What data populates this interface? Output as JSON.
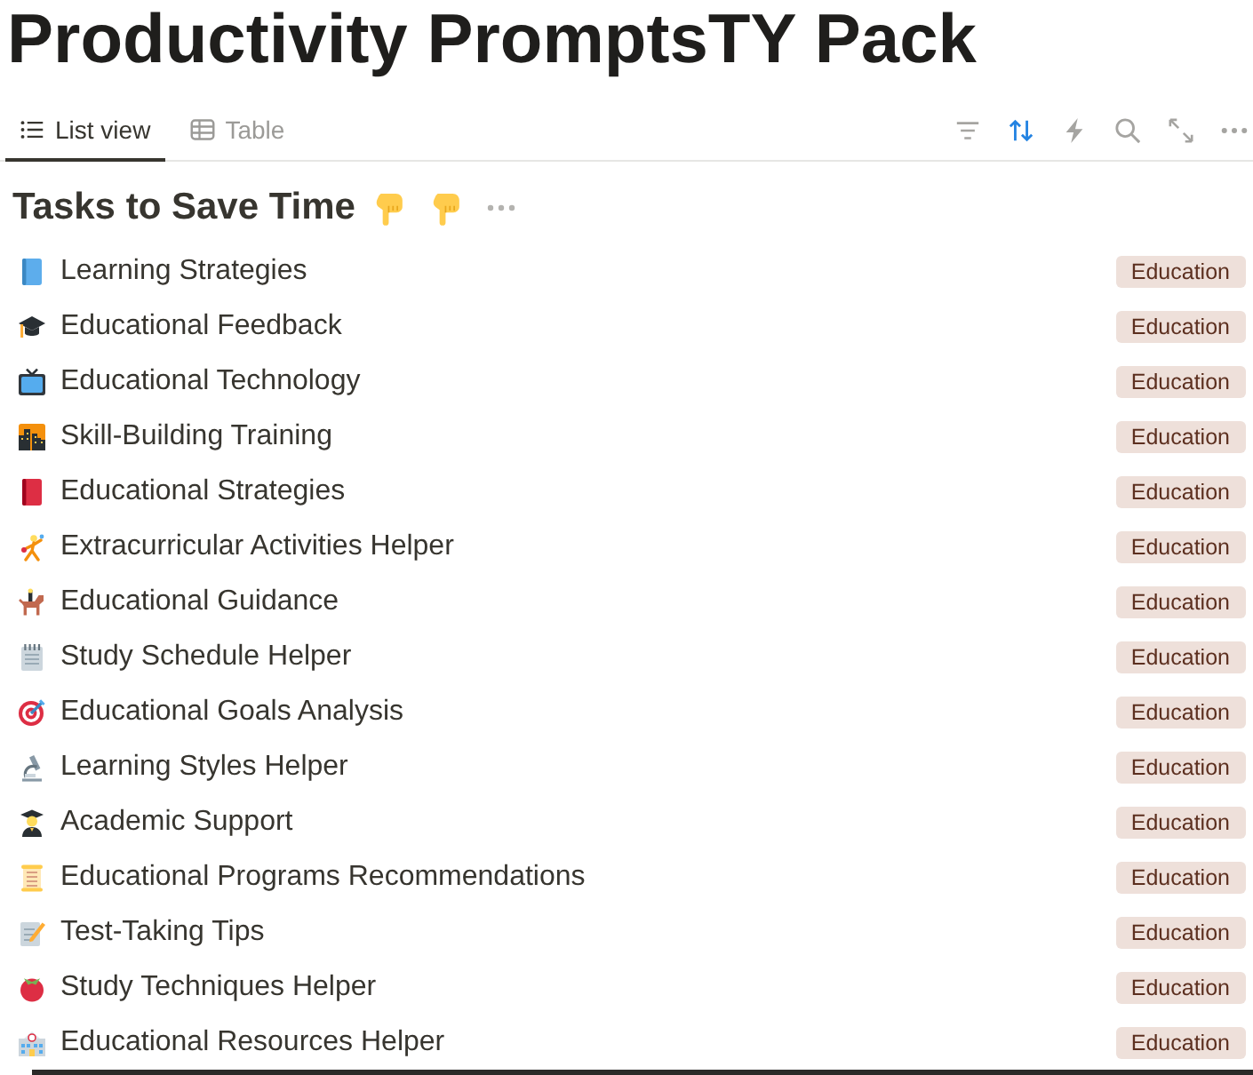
{
  "title": "Productivity PromptsTY Pack",
  "tabs": [
    {
      "label": "List view",
      "kind": "list",
      "selected": true
    },
    {
      "label": "Table",
      "kind": "table",
      "selected": false
    }
  ],
  "toolbar": [
    {
      "kind": "filter",
      "active": false
    },
    {
      "kind": "sort",
      "active": true
    },
    {
      "kind": "automation",
      "active": false
    },
    {
      "kind": "search",
      "active": false
    },
    {
      "kind": "expand",
      "active": false
    },
    {
      "kind": "more",
      "active": false
    }
  ],
  "section": {
    "title": "Tasks to Save Time"
  },
  "items": [
    {
      "name": "Learning Strategies",
      "tag": "Education"
    },
    {
      "name": "Educational Feedback",
      "tag": "Education"
    },
    {
      "name": "Educational Technology",
      "tag": "Education"
    },
    {
      "name": "Skill-Building Training",
      "tag": "Education"
    },
    {
      "name": "Educational Strategies",
      "tag": "Education"
    },
    {
      "name": "Extracurricular Activities Helper",
      "tag": "Education"
    },
    {
      "name": "Educational Guidance",
      "tag": "Education"
    },
    {
      "name": "Study Schedule Helper",
      "tag": "Education"
    },
    {
      "name": "Educational Goals Analysis",
      "tag": "Education"
    },
    {
      "name": "Learning Styles Helper",
      "tag": "Education"
    },
    {
      "name": "Academic Support",
      "tag": "Education"
    },
    {
      "name": "Educational Programs Recommendations",
      "tag": "Education"
    },
    {
      "name": "Test-Taking Tips",
      "tag": "Education"
    },
    {
      "name": "Study Techniques Helper",
      "tag": "Education"
    },
    {
      "name": "Educational Resources Helper",
      "tag": "Education"
    }
  ]
}
